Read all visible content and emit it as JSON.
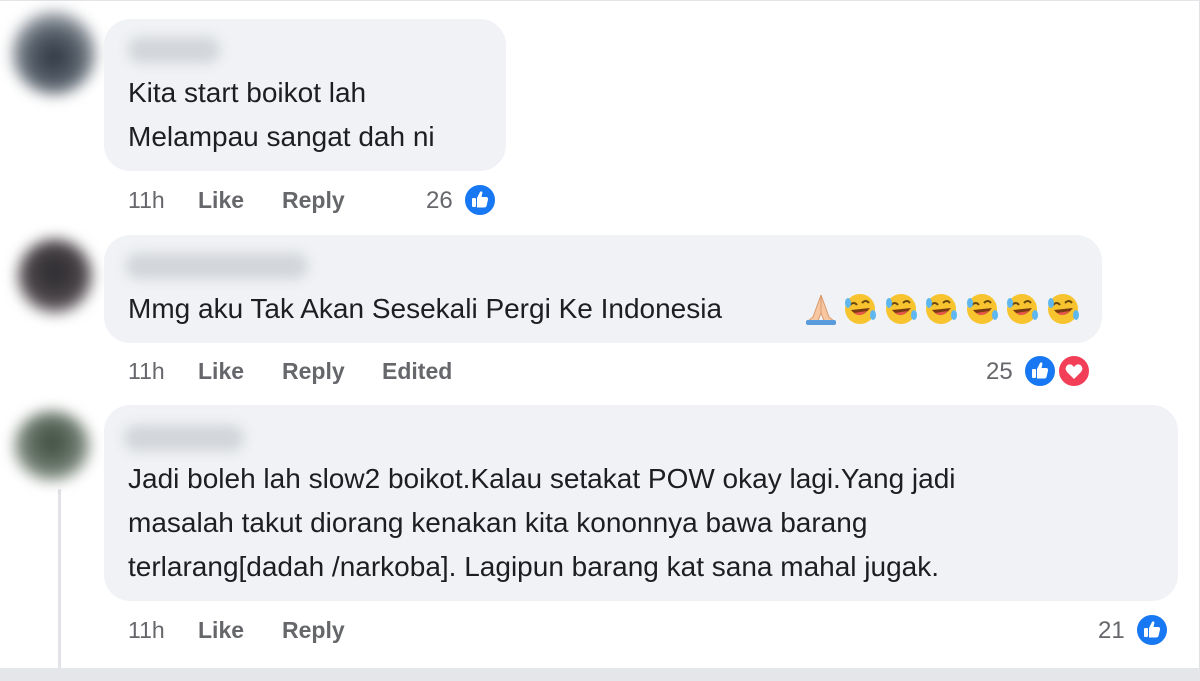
{
  "comments": [
    {
      "lines": [
        "Kita start boikot lah",
        "Melampau sangat dah ni"
      ],
      "time": "11h",
      "like_label": "Like",
      "reply_label": "Reply",
      "reaction_count": "26"
    },
    {
      "lines": [
        "Mmg aku Tak Akan Sesekali Pergi Ke Indonesia"
      ],
      "emojis": [
        "praying-hands",
        "rolling-laughing",
        "rolling-laughing",
        "rolling-laughing",
        "rolling-laughing",
        "rolling-laughing",
        "rolling-laughing"
      ],
      "time": "11h",
      "like_label": "Like",
      "reply_label": "Reply",
      "edited_label": "Edited",
      "reaction_count": "25"
    },
    {
      "lines": [
        "Jadi boleh lah slow2 boikot.Kalau setakat POW okay lagi.Yang jadi",
        "masalah takut diorang kenakan kita kononnya bawa barang",
        "terlarang[dadah /narkoba]. Lagipun barang kat sana mahal jugak."
      ],
      "time": "11h",
      "like_label": "Like",
      "reply_label": "Reply",
      "reaction_count": "21"
    }
  ],
  "colors": {
    "like_blue": "#1877f2",
    "love_red": "#f33e58",
    "bubble_bg": "#f0f2f5",
    "meta_gray": "#65676b"
  }
}
